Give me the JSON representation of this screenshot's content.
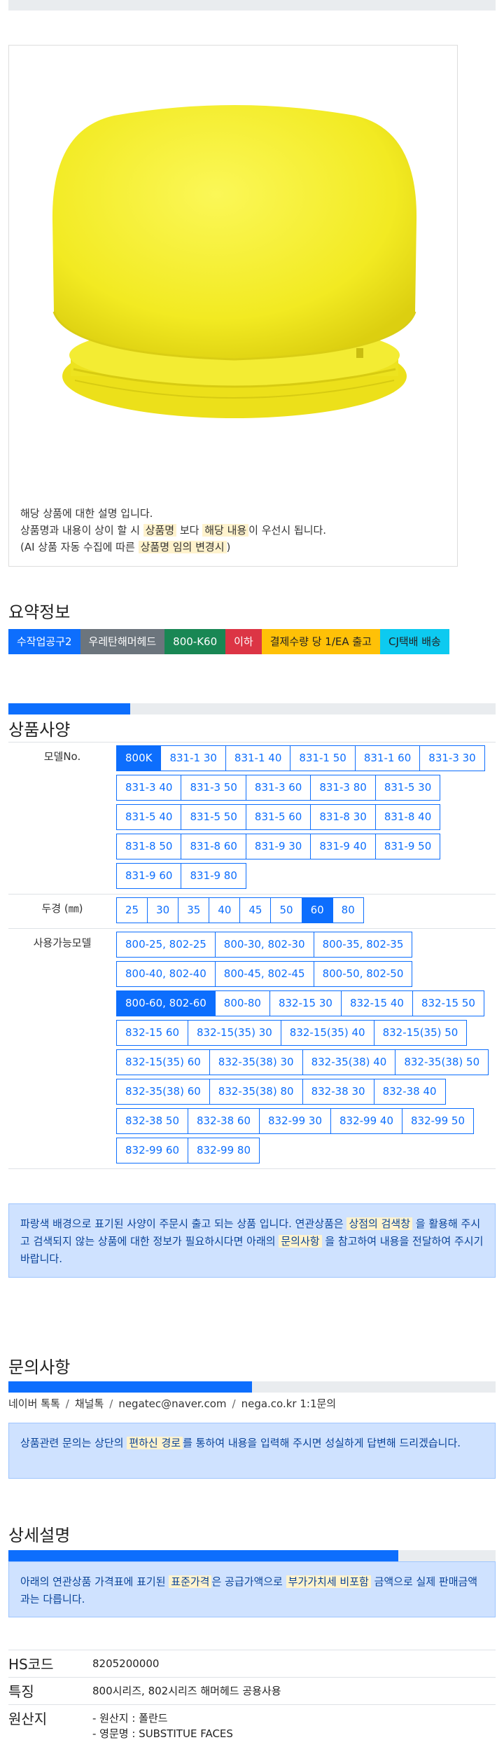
{
  "description": {
    "line1": "해당 상품에 대한 설명 입니다.",
    "line2_pre": "상품명과 내용이 상이 할 시 ",
    "line2_hl1": "상품명",
    "line2_mid": " 보다 ",
    "line2_hl2": "해당 내용",
    "line2_post": "이 우선시 됩니다.",
    "line3_pre": "(AI 상품 자동 수집에 따른 ",
    "line3_hl": "상품명 임의 변경시",
    "line3_post": ")"
  },
  "summary": {
    "title": "요약정보",
    "badges": [
      "수작업공구2",
      "우레탄해머헤드",
      "800-K60",
      "이하",
      "결제수량 당 1/EA 출고",
      "CJ택배 배송"
    ]
  },
  "spec": {
    "title": "상품사양",
    "progress_fraction": 0.25,
    "model_label": "모델No.",
    "models": [
      "800K",
      "831-1 30",
      "831-1 40",
      "831-1 50",
      "831-1 60",
      "831-3 30",
      "831-3 40",
      "831-3 50",
      "831-3 60",
      "831-3 80",
      "831-5 30",
      "831-5 40",
      "831-5 50",
      "831-5 60",
      "831-8 30",
      "831-8 40",
      "831-8 50",
      "831-8 60",
      "831-9 30",
      "831-9 40",
      "831-9 50",
      "831-9 60",
      "831-9 80"
    ],
    "diameter_label": "두경 (㎜)",
    "diameters": [
      "25",
      "30",
      "35",
      "40",
      "45",
      "50",
      "60",
      "80"
    ],
    "compat_label": "사용가능모델",
    "compat": [
      "800-25, 802-25",
      "800-30, 802-30",
      "800-35, 802-35",
      "800-40, 802-40",
      "800-45, 802-45",
      "800-50, 802-50",
      "800-60, 802-60",
      "800-80",
      "832-15 30",
      "832-15 40",
      "832-15 50",
      "832-15 60",
      "832-15(35) 30",
      "832-15(35) 40",
      "832-15(35) 50",
      "832-15(35) 60",
      "832-35(38) 30",
      "832-35(38) 40",
      "832-35(38) 50",
      "832-35(38) 60",
      "832-35(38) 80",
      "832-38 30",
      "832-38 40",
      "832-38 50",
      "832-38 60",
      "832-99 30",
      "832-99 40",
      "832-99 50",
      "832-99 60",
      "832-99 80"
    ],
    "info_pre": "파랑색 배경으로 표기된 사양이 주문시 출고 되는 상품 입니다. 연관상품은 ",
    "info_hl1": "상점의 검색창",
    "info_mid": " 을 활용해 주시고 검색되지 않는 상품에 대한 정보가 필요하시다면 아래의 ",
    "info_hl2": "문의사항",
    "info_post": " 을 참고하여 내용을 전달하여 주시기 바랍니다."
  },
  "inquiry": {
    "title": "문의사항",
    "progress_fraction": 0.5,
    "channels": [
      "네이버 톡톡",
      "채널톡",
      "negatec@naver.com",
      "nega.co.kr 1:1문의"
    ],
    "info_pre": "상품관련 문의는 상단의 ",
    "info_hl": "편하신 경로",
    "info_post": "를 통하여 내용을 입력해 주시면 성실하게 답변해 드리겠습니다."
  },
  "detail": {
    "title": "상세설명",
    "progress_fraction": 0.8,
    "info_pre": "아래의 연관상품 가격표에 표기된 ",
    "info_hl1": "표준가격",
    "info_mid": "은 공급가액으로 ",
    "info_hl2": "부가가치세 비포함",
    "info_post": " 금액으로 실제 판매금액과는 다릅니다.",
    "rows": [
      {
        "key": "HS코드",
        "value": "8205200000"
      },
      {
        "key": "특징",
        "value": "800시리즈, 802시리즈 해머헤드 공용사용"
      },
      {
        "key": "원산지",
        "value": "- 원산지 : 폴란드",
        "value2": "- 영문명 : SUBSTITUE FACES"
      }
    ]
  },
  "colors": {
    "primary": "#0d6efd",
    "product_yellow": "#f4ef3a"
  }
}
